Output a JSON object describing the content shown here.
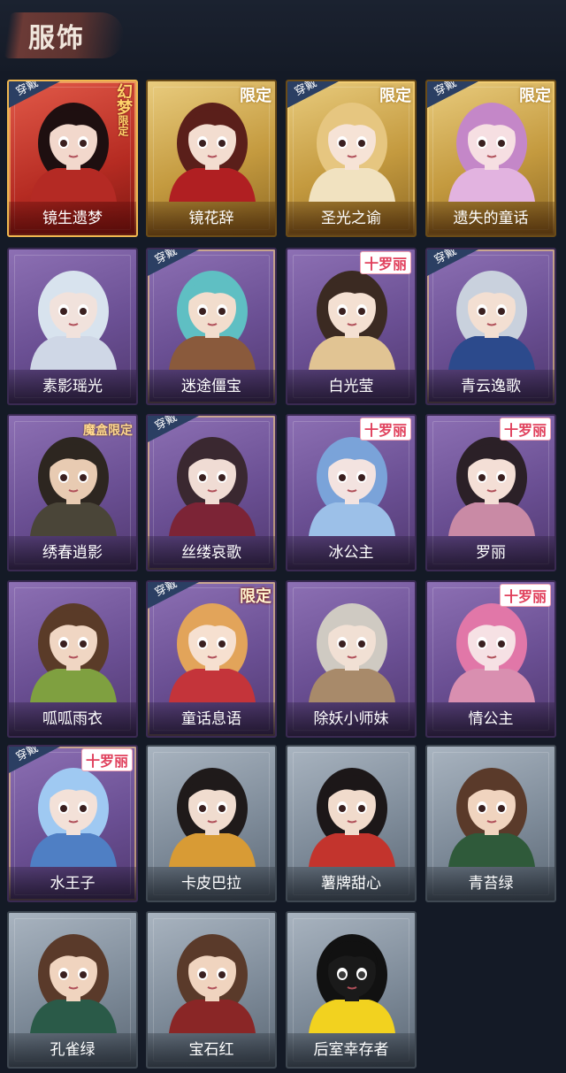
{
  "header": {
    "title": "服饰"
  },
  "badges": {
    "worn": "穿戴",
    "limited": "限定",
    "luoli": "十罗丽",
    "magic_box": "魔盒限定",
    "dream": "幻梦",
    "dream_limited": "限定"
  },
  "cards": [
    {
      "name": "镜生遗梦",
      "theme": "red",
      "worn": true,
      "tag": "dream",
      "hair": "#1e0f10",
      "outfit": "#b42a24",
      "skin": "#f2d8cc"
    },
    {
      "name": "镜花辞",
      "theme": "gold",
      "worn": false,
      "tag": "limited",
      "hair": "#5a1f1a",
      "outfit": "#b01f22",
      "skin": "#f3ddd0"
    },
    {
      "name": "圣光之谕",
      "theme": "gold",
      "worn": true,
      "tag": "limited",
      "hair": "#e6c680",
      "outfit": "#f1e2c0",
      "skin": "#f6e3d6"
    },
    {
      "name": "遗失的童话",
      "theme": "gold",
      "worn": true,
      "tag": "limited",
      "hair": "#c487c8",
      "outfit": "#e2b3e0",
      "skin": "#f6dfe2"
    },
    {
      "name": "素影瑶光",
      "theme": "purple",
      "worn": false,
      "tag": "",
      "hair": "#d8e3ee",
      "outfit": "#cfd7e6",
      "skin": "#f1e2dc"
    },
    {
      "name": "迷途僵宝",
      "theme": "purple",
      "worn": true,
      "tag": "",
      "hair": "#5fbfc3",
      "outfit": "#8a5a3c",
      "skin": "#f2ddcd"
    },
    {
      "name": "白光莹",
      "theme": "purple",
      "worn": false,
      "tag": "luoli",
      "hair": "#3b2a22",
      "outfit": "#e1c493",
      "skin": "#f4e0d2"
    },
    {
      "name": "青云逸歌",
      "theme": "purple",
      "worn": true,
      "tag": "",
      "hair": "#c9d1dd",
      "outfit": "#2c4a8c",
      "skin": "#f3dfd2"
    },
    {
      "name": "绣春逍影",
      "theme": "purple",
      "worn": false,
      "tag": "magic_box",
      "hair": "#2d2620",
      "outfit": "#4a4538",
      "skin": "#e8cbb2"
    },
    {
      "name": "丝缕哀歌",
      "theme": "purple",
      "worn": true,
      "tag": "",
      "hair": "#3a2830",
      "outfit": "#7c2436",
      "skin": "#f0dcd4"
    },
    {
      "name": "冰公主",
      "theme": "purple",
      "worn": false,
      "tag": "luoli",
      "hair": "#7aa3d9",
      "outfit": "#9cc0e8",
      "skin": "#f3e3e0"
    },
    {
      "name": "罗丽",
      "theme": "purple",
      "worn": false,
      "tag": "luoli",
      "hair": "#2b2027",
      "outfit": "#c98aa5",
      "skin": "#f4dfd6"
    },
    {
      "name": "呱呱雨衣",
      "theme": "purple",
      "worn": false,
      "tag": "",
      "hair": "#5a3b28",
      "outfit": "#7fa040",
      "skin": "#f0d6c3"
    },
    {
      "name": "童话息语",
      "theme": "purple",
      "worn": true,
      "tag": "limited",
      "hair": "#e2a45a",
      "outfit": "#c4343a",
      "skin": "#f6e0d0"
    },
    {
      "name": "除妖小师妹",
      "theme": "purple",
      "worn": false,
      "tag": "",
      "hair": "#cfcac2",
      "outfit": "#a88a6a",
      "skin": "#f1e0d4"
    },
    {
      "name": "情公主",
      "theme": "purple",
      "worn": false,
      "tag": "luoli",
      "hair": "#e177a8",
      "outfit": "#d98fb0",
      "skin": "#f6e1e4"
    },
    {
      "name": "水王子",
      "theme": "purple",
      "worn": true,
      "tag": "luoli",
      "hair": "#9fc9f2",
      "outfit": "#4f7fc4",
      "skin": "#f3e1d8"
    },
    {
      "name": "卡皮巴拉",
      "theme": "gray",
      "worn": false,
      "tag": "",
      "hair": "#1f1a1a",
      "outfit": "#d89b35",
      "skin": "#f0dccf"
    },
    {
      "name": "薯牌甜心",
      "theme": "gray",
      "worn": false,
      "tag": "",
      "hair": "#1c1718",
      "outfit": "#c3342d",
      "skin": "#f1dbcc"
    },
    {
      "name": "青苔绿",
      "theme": "gray",
      "worn": false,
      "tag": "",
      "hair": "#5a3a2a",
      "outfit": "#2f5a3a",
      "skin": "#f0d4bf"
    },
    {
      "name": "孔雀绿",
      "theme": "gray",
      "worn": false,
      "tag": "",
      "hair": "#5a3a2a",
      "outfit": "#2a5a48",
      "skin": "#f0d4bf"
    },
    {
      "name": "宝石红",
      "theme": "gray",
      "worn": false,
      "tag": "",
      "hair": "#5a3a2a",
      "outfit": "#8a2626",
      "skin": "#f0d4bf"
    },
    {
      "name": "后室幸存者",
      "theme": "gray",
      "worn": false,
      "tag": "",
      "hair": "#111111",
      "outfit": "#f2d21f",
      "skin": "#1a1a1a"
    }
  ]
}
